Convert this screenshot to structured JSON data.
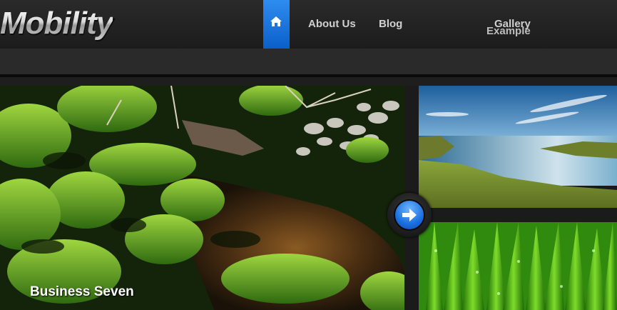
{
  "header": {
    "logo_text": "Mobility",
    "home_icon": "house-icon"
  },
  "nav": {
    "about": "About Us",
    "blog": "Blog",
    "gallery": "Gallery",
    "example": "Example"
  },
  "slider": {
    "caption": "Business Seven",
    "next_icon": "arrow-right-icon"
  },
  "colors": {
    "accent": "#1a6fe0",
    "background": "#1a1a1a",
    "nav_text": "#d0d0d0"
  }
}
